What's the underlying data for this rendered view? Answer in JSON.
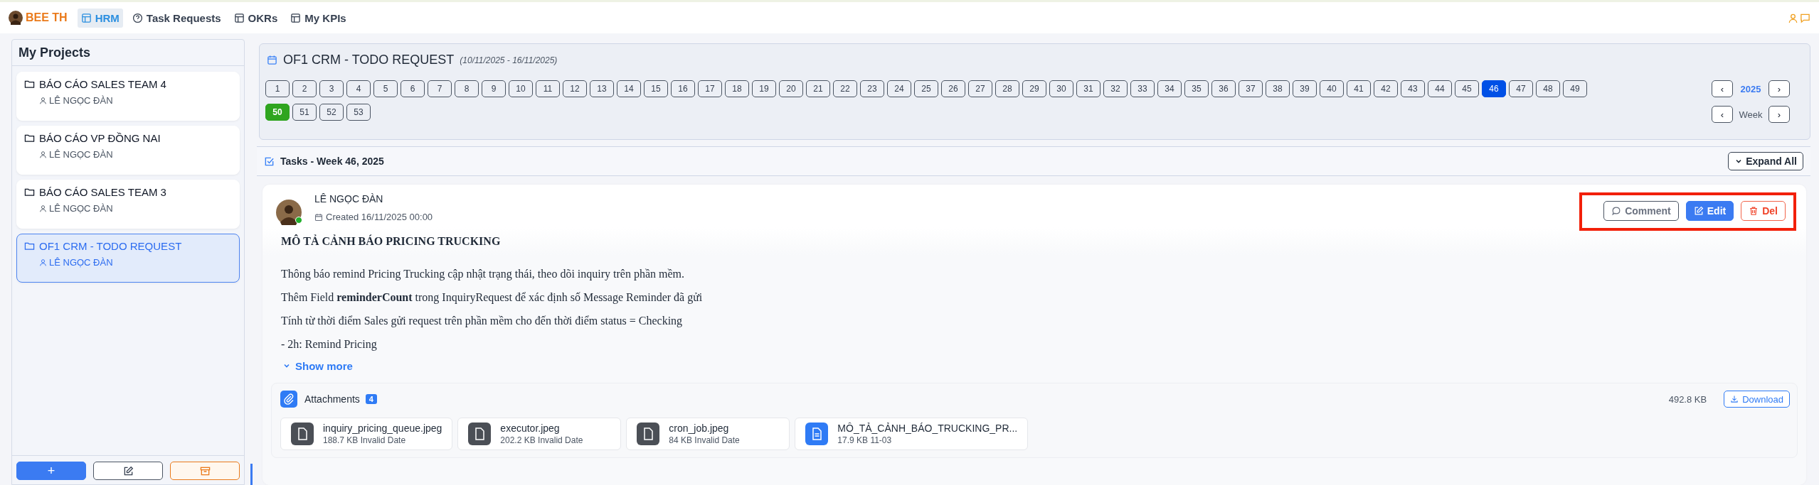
{
  "brand": {
    "name": "BEE TH"
  },
  "nav": [
    {
      "label": "HRM",
      "kind": "table",
      "selected": true
    },
    {
      "label": "Task Requests",
      "kind": "help",
      "selected": false
    },
    {
      "label": "OKRs",
      "kind": "table",
      "selected": false
    },
    {
      "label": "My KPIs",
      "kind": "table",
      "selected": false
    }
  ],
  "sidebar": {
    "title": "My Projects",
    "projects": [
      {
        "name": "BÁO CÁO SALES TEAM 4",
        "owner": "LÊ NGỌC ĐÀN",
        "selected": false
      },
      {
        "name": "BÁO CÁO VP ĐỒNG NAI",
        "owner": "LÊ NGỌC ĐÀN",
        "selected": false
      },
      {
        "name": "BÁO CÁO SALES TEAM 3",
        "owner": "LÊ NGỌC ĐÀN",
        "selected": false
      },
      {
        "name": "OF1 CRM - TODO REQUEST",
        "owner": "LÊ NGỌC ĐÀN",
        "selected": true
      }
    ],
    "add_button": "+"
  },
  "week_panel": {
    "title": "OF1 CRM - TODO REQUEST",
    "range": "(10/11/2025 - 16/11/2025)",
    "weeks": [
      {
        "label": "1",
        "selected": false,
        "current": false
      },
      {
        "label": "2",
        "selected": false,
        "current": false
      },
      {
        "label": "3",
        "selected": false,
        "current": false
      },
      {
        "label": "4",
        "selected": false,
        "current": false
      },
      {
        "label": "5",
        "selected": false,
        "current": false
      },
      {
        "label": "6",
        "selected": false,
        "current": false
      },
      {
        "label": "7",
        "selected": false,
        "current": false
      },
      {
        "label": "8",
        "selected": false,
        "current": false
      },
      {
        "label": "9",
        "selected": false,
        "current": false
      },
      {
        "label": "10",
        "selected": false,
        "current": false
      },
      {
        "label": "11",
        "selected": false,
        "current": false
      },
      {
        "label": "12",
        "selected": false,
        "current": false
      },
      {
        "label": "13",
        "selected": false,
        "current": false
      },
      {
        "label": "14",
        "selected": false,
        "current": false
      },
      {
        "label": "15",
        "selected": false,
        "current": false
      },
      {
        "label": "16",
        "selected": false,
        "current": false
      },
      {
        "label": "17",
        "selected": false,
        "current": false
      },
      {
        "label": "18",
        "selected": false,
        "current": false
      },
      {
        "label": "19",
        "selected": false,
        "current": false
      },
      {
        "label": "20",
        "selected": false,
        "current": false
      },
      {
        "label": "21",
        "selected": false,
        "current": false
      },
      {
        "label": "22",
        "selected": false,
        "current": false
      },
      {
        "label": "23",
        "selected": false,
        "current": false
      },
      {
        "label": "24",
        "selected": false,
        "current": false
      },
      {
        "label": "25",
        "selected": false,
        "current": false
      },
      {
        "label": "26",
        "selected": false,
        "current": false
      },
      {
        "label": "27",
        "selected": false,
        "current": false
      },
      {
        "label": "28",
        "selected": false,
        "current": false
      },
      {
        "label": "29",
        "selected": false,
        "current": false
      },
      {
        "label": "30",
        "selected": false,
        "current": false
      },
      {
        "label": "31",
        "selected": false,
        "current": false
      },
      {
        "label": "32",
        "selected": false,
        "current": false
      },
      {
        "label": "33",
        "selected": false,
        "current": false
      },
      {
        "label": "34",
        "selected": false,
        "current": false
      },
      {
        "label": "35",
        "selected": false,
        "current": false
      },
      {
        "label": "36",
        "selected": false,
        "current": false
      },
      {
        "label": "37",
        "selected": false,
        "current": false
      },
      {
        "label": "38",
        "selected": false,
        "current": false
      },
      {
        "label": "39",
        "selected": false,
        "current": false
      },
      {
        "label": "40",
        "selected": false,
        "current": false
      },
      {
        "label": "41",
        "selected": false,
        "current": false
      },
      {
        "label": "42",
        "selected": false,
        "current": false
      },
      {
        "label": "43",
        "selected": false,
        "current": false
      },
      {
        "label": "44",
        "selected": false,
        "current": false
      },
      {
        "label": "45",
        "selected": false,
        "current": false
      },
      {
        "label": "46",
        "selected": true,
        "current": false
      },
      {
        "label": "47",
        "selected": false,
        "current": false
      },
      {
        "label": "48",
        "selected": false,
        "current": false
      },
      {
        "label": "49",
        "selected": false,
        "current": false
      },
      {
        "label": "50",
        "selected": false,
        "current": true
      },
      {
        "label": "51",
        "selected": false,
        "current": false
      },
      {
        "label": "52",
        "selected": false,
        "current": false
      },
      {
        "label": "53",
        "selected": false,
        "current": false
      }
    ],
    "year_prev": "‹",
    "year": "2025",
    "year_next": "›",
    "week_prev": "‹",
    "week_label": "Week",
    "week_next": "›"
  },
  "tasks": {
    "title": "Tasks - Week 46, 2025",
    "expand_button": "Expand All"
  },
  "task": {
    "author": "LÊ NGỌC ĐÀN",
    "online": true,
    "created": "Created 16/11/2025 00:00",
    "actions_highlighted": true,
    "actions": [
      {
        "label": "Comment",
        "kind": "comment"
      },
      {
        "label": "Edit",
        "kind": "edit"
      },
      {
        "label": "Del",
        "kind": "delete"
      }
    ],
    "heading": "MÔ TẢ CẢNH BÁO PRICING TRUCKING",
    "paragraphs": [
      "Thông báo remind Pricing Trucking cập nhật trạng thái, theo dõi inquiry trên phần mềm.",
      "Thêm Field **reminderCount** trong InquiryRequest để xác định số Message Reminder đã gửi",
      "Tính từ thời điểm Sales gửi request trên phần mềm cho đến thời điểm status = Checking",
      "- 2h: Remind Pricing"
    ],
    "show_more": "Show more",
    "attachments": {
      "title": "Attachments",
      "count": "4",
      "total_size": "492.8 KB",
      "download": "Download",
      "files": [
        {
          "name": "inquiry_pricing_queue.jpeg",
          "meta": "188.7 KB Invalid Date",
          "kind": "image"
        },
        {
          "name": "executor.jpeg",
          "meta": "202.2 KB Invalid Date",
          "kind": "image"
        },
        {
          "name": "cron_job.jpeg",
          "meta": "84 KB Invalid Date",
          "kind": "image"
        },
        {
          "name": "MÔ_TẢ_CẢNH_BÁO_TRUCKING_PR...",
          "meta": "17.9 KB 11-03",
          "kind": "document"
        }
      ]
    }
  }
}
